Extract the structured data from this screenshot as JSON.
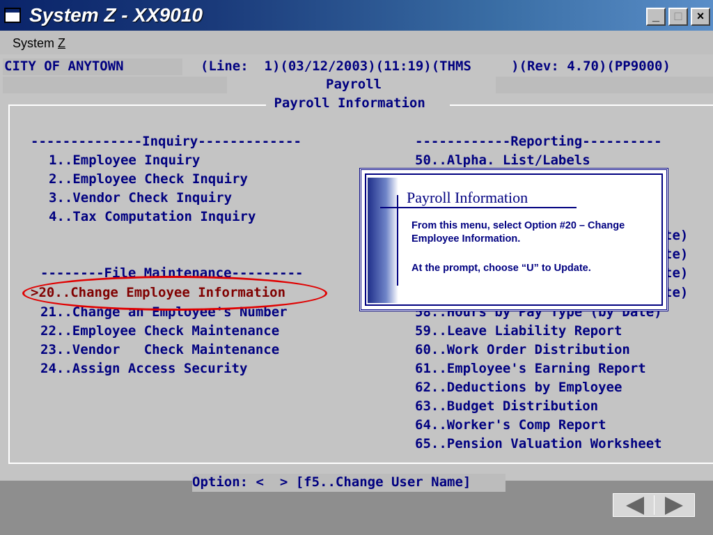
{
  "window": {
    "title": "System Z - XX9010",
    "min": "_",
    "max": "□",
    "close": "×"
  },
  "menu": {
    "system_prefix": "System ",
    "system_underlined": "Z"
  },
  "header": {
    "city": "CITY OF ANYTOWN",
    "status": "(Line:  1)(03/12/2003)(11:19)(THMS     )(Rev: 4.70)(PP9000)",
    "module": "Payroll",
    "panel_title": " Payroll Information "
  },
  "inquiry": {
    "heading": "--------------Inquiry-------------",
    "items": [
      "1..Employee Inquiry",
      "2..Employee Check Inquiry",
      "3..Vendor Check Inquiry",
      "4..Tax Computation Inquiry"
    ]
  },
  "file_maintenance": {
    "heading": "--------File Maintenance---------",
    "items": [
      ">20..Change Employee Information",
      "21..Change an Employee's Number",
      "22..Employee Check Maintenance",
      "23..Vendor   Check Maintenance",
      "24..Assign Access Security"
    ]
  },
  "reporting": {
    "heading": "------------Reporting----------",
    "items": [
      "50..Alpha. List/Labels",
      "te)",
      "te)",
      "te)",
      "te)",
      "58..Hours by Pay Type (by Date)",
      "59..Leave Liability Report",
      "60..Work Order Distribution",
      "61..Employee's Earning Report",
      "62..Deductions by Employee",
      "63..Budget Distribution",
      "64..Worker's Comp Report",
      "65..Pension Valuation Worksheet"
    ]
  },
  "option_line": "Option: <  > [f5..Change User Name]",
  "callout": {
    "title": "Payroll Information",
    "line1": "From this menu, select Option #20 – Change Employee Information.",
    "line2": "At the prompt, choose “U” to Update."
  },
  "nav": {
    "prev_icon": "triangle-left-icon",
    "next_icon": "triangle-right-icon"
  }
}
